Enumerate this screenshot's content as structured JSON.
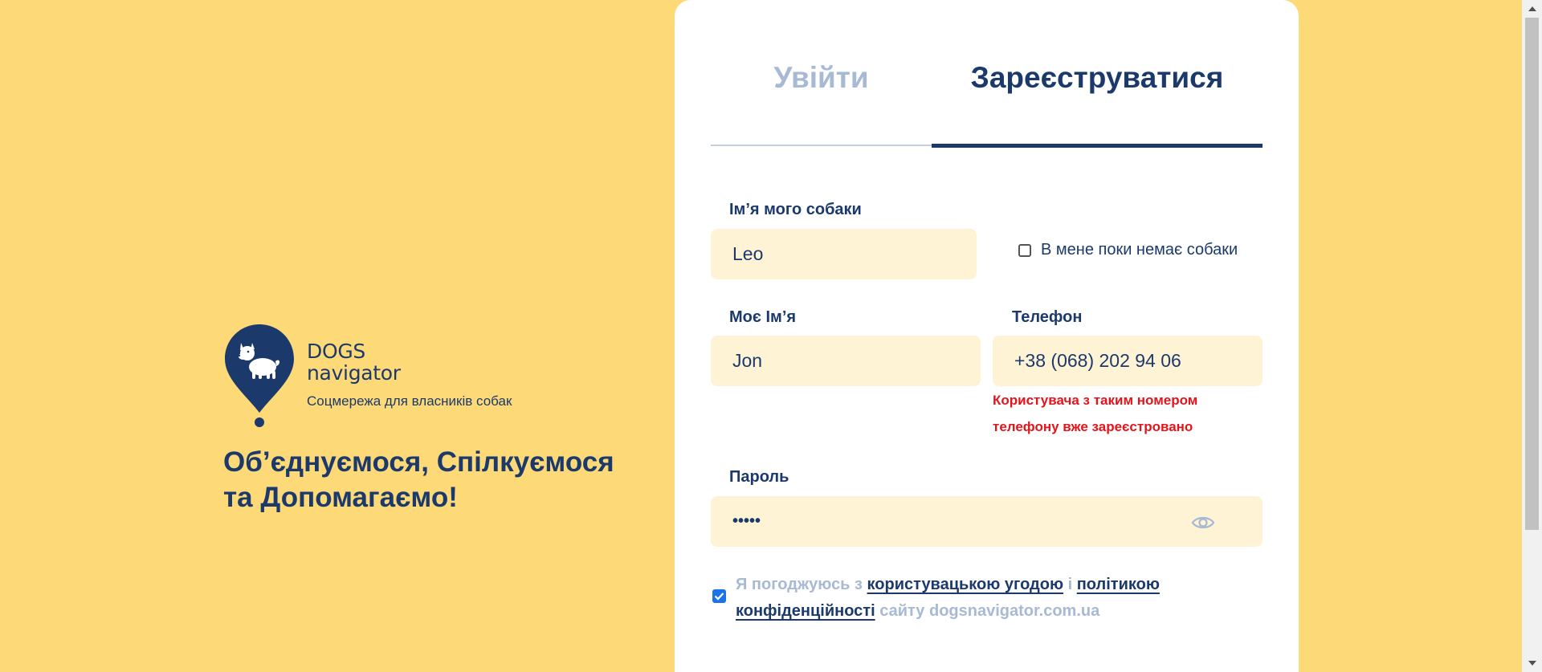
{
  "brand": {
    "name_line1": "DOGS",
    "name_line2": "navigator",
    "tagline": "Соцмережа для власників собак",
    "slogan_line1": "Об’єднуємося, Спілкуємося",
    "slogan_line2": "та Допомагаємо!"
  },
  "tabs": {
    "login": "Увійти",
    "register": "Зареєструватися"
  },
  "form": {
    "dog_name_label": "Ім’я мого собаки",
    "dog_name_value": "Leo",
    "no_dog_label": "В мене поки немає собаки",
    "my_name_label": "Моє Ім’я",
    "my_name_value": "Jon",
    "phone_label": "Телефон",
    "phone_value": "+38 (068) 202 94 06",
    "phone_error_line1": "Користувача з таким номером",
    "phone_error_line2": "телефону вже зареєстровано",
    "password_label": "Пароль",
    "password_value": "•••••",
    "agree_prefix": "Я погоджуюсь з ",
    "agree_link1": "користувацькою угодою",
    "agree_and": " і ",
    "agree_link2_part1": "політикою",
    "agree_link2_part2": "конфіденційності",
    "agree_suffix": " сайту dogsnavigator.com.ua"
  },
  "colors": {
    "background": "#FED978",
    "navy": "#1B3A6B",
    "input_bg": "#FFF3D6",
    "error": "#E4141B",
    "muted": "#A7B9D4"
  }
}
